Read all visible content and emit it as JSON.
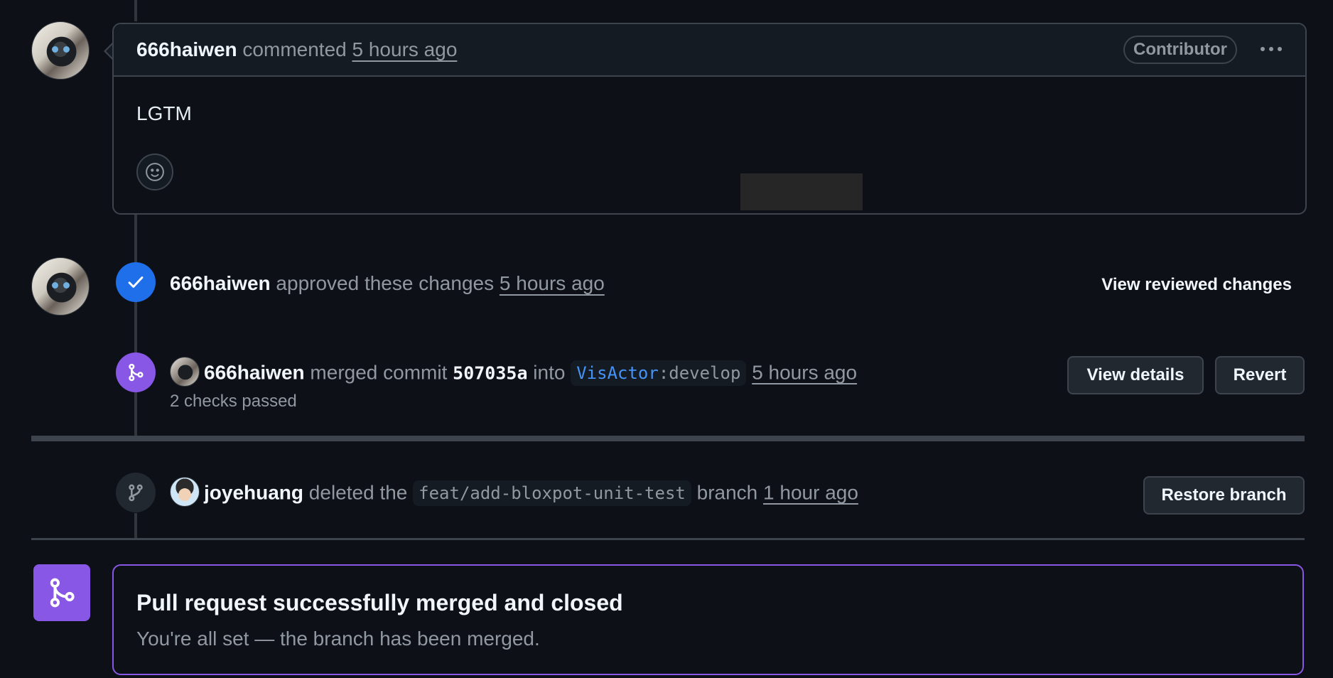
{
  "comment": {
    "author": "666haiwen",
    "action": "commented",
    "time": "5 hours ago",
    "badge": "Contributor",
    "body": "LGTM"
  },
  "approval": {
    "author": "666haiwen",
    "action": "approved these changes",
    "time": "5 hours ago",
    "link": "View reviewed changes"
  },
  "merge": {
    "author": "666haiwen",
    "action": "merged commit",
    "commit": "507035a",
    "into": "into",
    "owner": "VisActor",
    "branch": ":develop",
    "time": "5 hours ago",
    "checks": "2 checks passed",
    "details_button": "View details",
    "revert_button": "Revert"
  },
  "delete": {
    "author": "joyehuang",
    "action": "deleted the",
    "branch": "feat/add-bloxpot-unit-test",
    "suffix": "branch",
    "time": "1 hour ago",
    "restore_button": "Restore branch"
  },
  "merged_box": {
    "title": "Pull request successfully merged and closed",
    "subtitle": "You're all set — the branch has been merged."
  },
  "colors": {
    "background": "#0d1117",
    "approve": "#1f6feb",
    "merged": "#8957e5",
    "link": "#4493f8"
  }
}
